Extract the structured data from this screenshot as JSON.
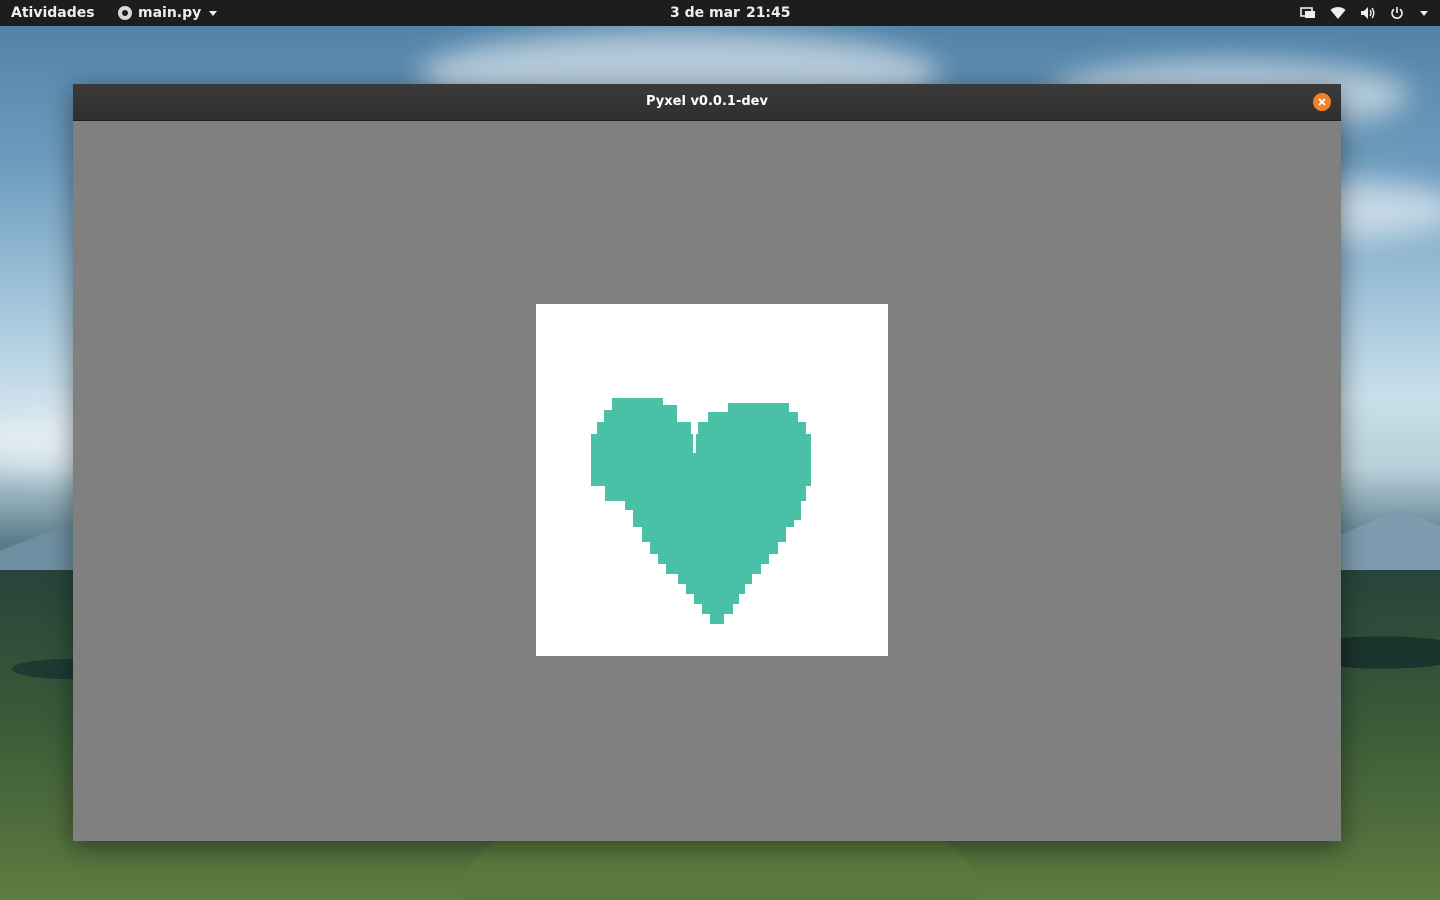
{
  "topbar": {
    "activities": "Atividades",
    "app_name": "main.py",
    "clock_date": "3 de mar",
    "clock_time": "21:45",
    "icons": [
      "screen-share-icon",
      "wifi-icon",
      "volume-icon",
      "power-icon",
      "system-menu-caret-icon"
    ]
  },
  "window": {
    "title": "Pyxel v0.0.1-dev",
    "close_icon": "close-icon",
    "close_color": "#f3812c",
    "background_color": "#808080"
  },
  "canvas": {
    "background_color": "#ffffff",
    "heart_color": "#4ac1a6",
    "shape": "heart"
  }
}
